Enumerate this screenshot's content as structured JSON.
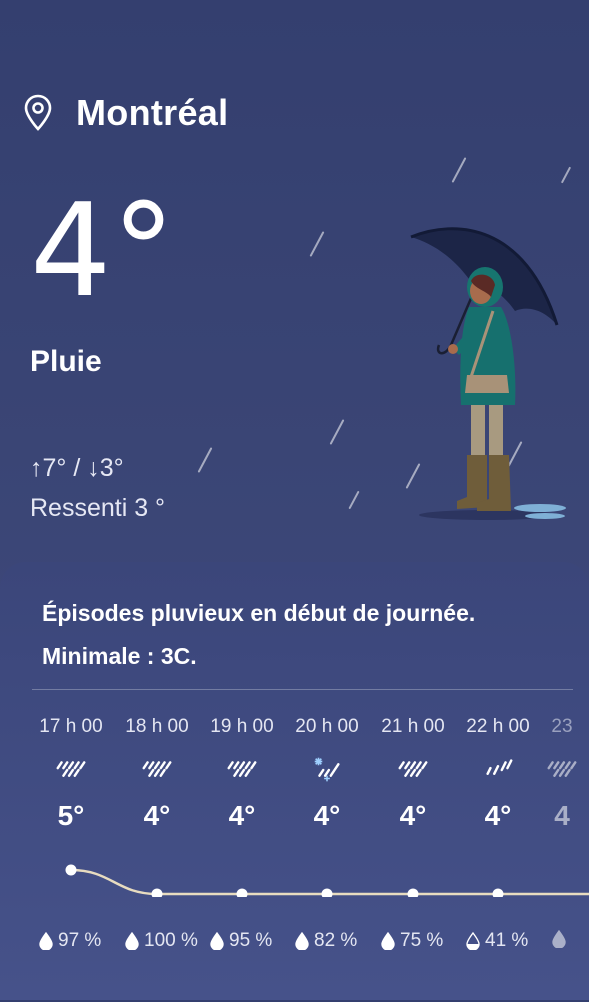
{
  "location": {
    "city": "Montréal",
    "icon": "location-pin-icon"
  },
  "current": {
    "temperature": "4°",
    "condition": "Pluie",
    "high_low": "↑7° / ↓3°",
    "feels_like": "Ressenti 3 °"
  },
  "forecast": {
    "summary_line1": "Épisodes pluvieux en début de journée.",
    "summary_line2": "Minimale : 3C.",
    "hours": [
      {
        "time": "17 h 00",
        "temp": "5°",
        "precip": "97 %",
        "icon": "rain-icon",
        "value": 5
      },
      {
        "time": "18 h 00",
        "temp": "4°",
        "precip": "100 %",
        "icon": "rain-icon",
        "value": 4
      },
      {
        "time": "19 h 00",
        "temp": "4°",
        "precip": "95 %",
        "icon": "rain-icon",
        "value": 4
      },
      {
        "time": "20 h 00",
        "temp": "4°",
        "precip": "82 %",
        "icon": "rain-snow-icon",
        "value": 4
      },
      {
        "time": "21 h 00",
        "temp": "4°",
        "precip": "75 %",
        "icon": "rain-icon",
        "value": 4
      },
      {
        "time": "22 h 00",
        "temp": "4°",
        "precip": "41 %",
        "icon": "light-rain-icon",
        "value": 4
      },
      {
        "time": "23",
        "temp": "4",
        "precip": "",
        "icon": "rain-icon",
        "value": 4
      }
    ]
  },
  "colors": {
    "background": "#343f6f",
    "card": "#3b467a",
    "line": "#e8dcc0"
  }
}
